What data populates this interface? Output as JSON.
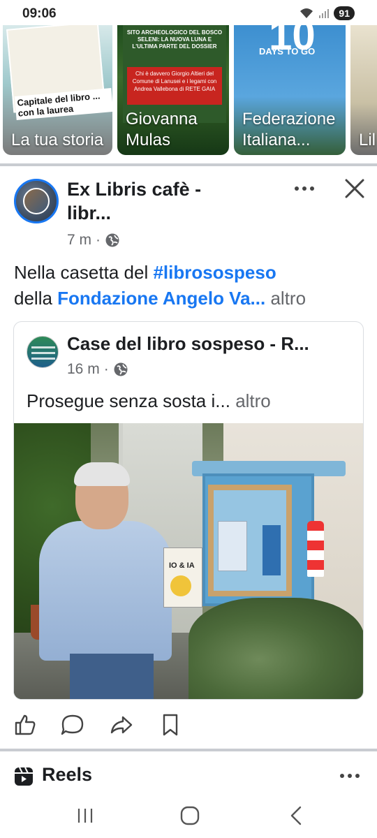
{
  "status_bar": {
    "time": "09:06",
    "battery": "91"
  },
  "stories": [
    {
      "label": "La tua storia",
      "caption": "Capitale del libro ... con la laurea"
    },
    {
      "label": "Giovanna Mulas",
      "poster_title": "SITO ARCHEOLOGICO DEL BOSCO SELENI: LA NUOVA LUNA E L'ULTIMA PARTE DEL DOSSIER",
      "poster_red": "Chi è davvero Giorgio Altieri del Comune di Lanusei e i legami con Andrea Vallebona di RETE GAIA"
    },
    {
      "label": "Federazione Italiana...",
      "big": "10",
      "days": "DAYS TO GO"
    },
    {
      "label": "Lil"
    }
  ],
  "post": {
    "page_name": "Ex Libris cafè - libr...",
    "time": "7 m",
    "text_1": "Nella casetta del ",
    "hashtag": "#librosospeso",
    "text_2": "della ",
    "mention": "Fondazione Angelo Va...",
    "more": "altro",
    "more_icon": "more-horizontal-icon",
    "close_icon": "close-icon"
  },
  "shared": {
    "name": "Case del libro sospeso - R...",
    "time": "16 m",
    "text": "Prosegue senza sosta i...",
    "more": "altro",
    "book_title": "IO & IA"
  },
  "actions": [
    "like-icon",
    "comment-icon",
    "share-icon",
    "save-icon"
  ],
  "reels": {
    "label": "Reels"
  },
  "nav": [
    "recent-apps-icon",
    "home-icon",
    "back-icon"
  ],
  "colors": {
    "accent": "#1877f2",
    "meta": "#65676b",
    "divider": "#c9ccd1"
  }
}
